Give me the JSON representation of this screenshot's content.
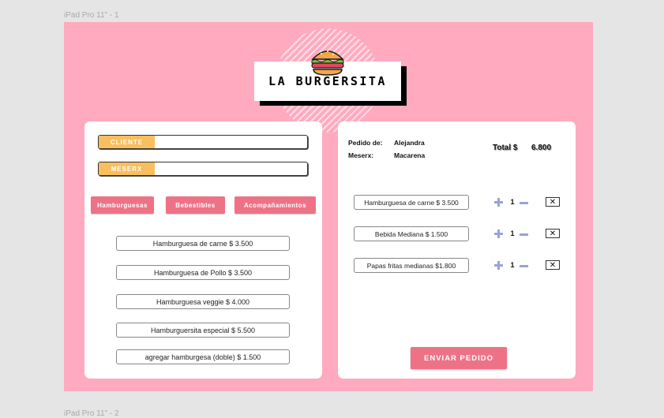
{
  "frame_label_top": "iPad Pro 11\" - 1",
  "frame_label_bottom": "iPad Pro 11\" - 2",
  "header": {
    "title": "LA BURGERSITA",
    "logo_icon": "burger-icon"
  },
  "form": {
    "cliente_label": "CLIENTE",
    "cliente_value": "",
    "mesero_label": "MESERX",
    "mesero_value": ""
  },
  "categories": [
    "Hamburguesas",
    "Bebestibles",
    "Acompañamientos"
  ],
  "menu_items": [
    "Hamburguesa de carne  $ 3.500",
    "Hamburguesa de Pollo $ 3.500",
    "Hamburguesa veggie $ 4.000",
    "Hamburguersita especial $ 5.500",
    "agregar hamburgesa (doble) $ 1.500"
  ],
  "order": {
    "pedido_label": "Pedido de:",
    "pedido_value": "Alejandra",
    "mesero_label": "Meserx:",
    "mesero_value": "Macarena",
    "total_label": "Total $",
    "total_value": "6.800",
    "items": [
      {
        "name": "Hamburguesa de carne  $ 3.500",
        "qty": "1"
      },
      {
        "name": "Bebida Mediana $ 1.500",
        "qty": "1"
      },
      {
        "name": "Papas fritas medianas $1.800",
        "qty": "1"
      }
    ],
    "remove_glyph": "✕",
    "send_label": "ENVIAR PEDIDO"
  },
  "colors": {
    "background": "#ffaabf",
    "accent_pink": "#ee7286",
    "accent_yellow": "#f9be5d",
    "stepper": "#9aa2d8"
  }
}
